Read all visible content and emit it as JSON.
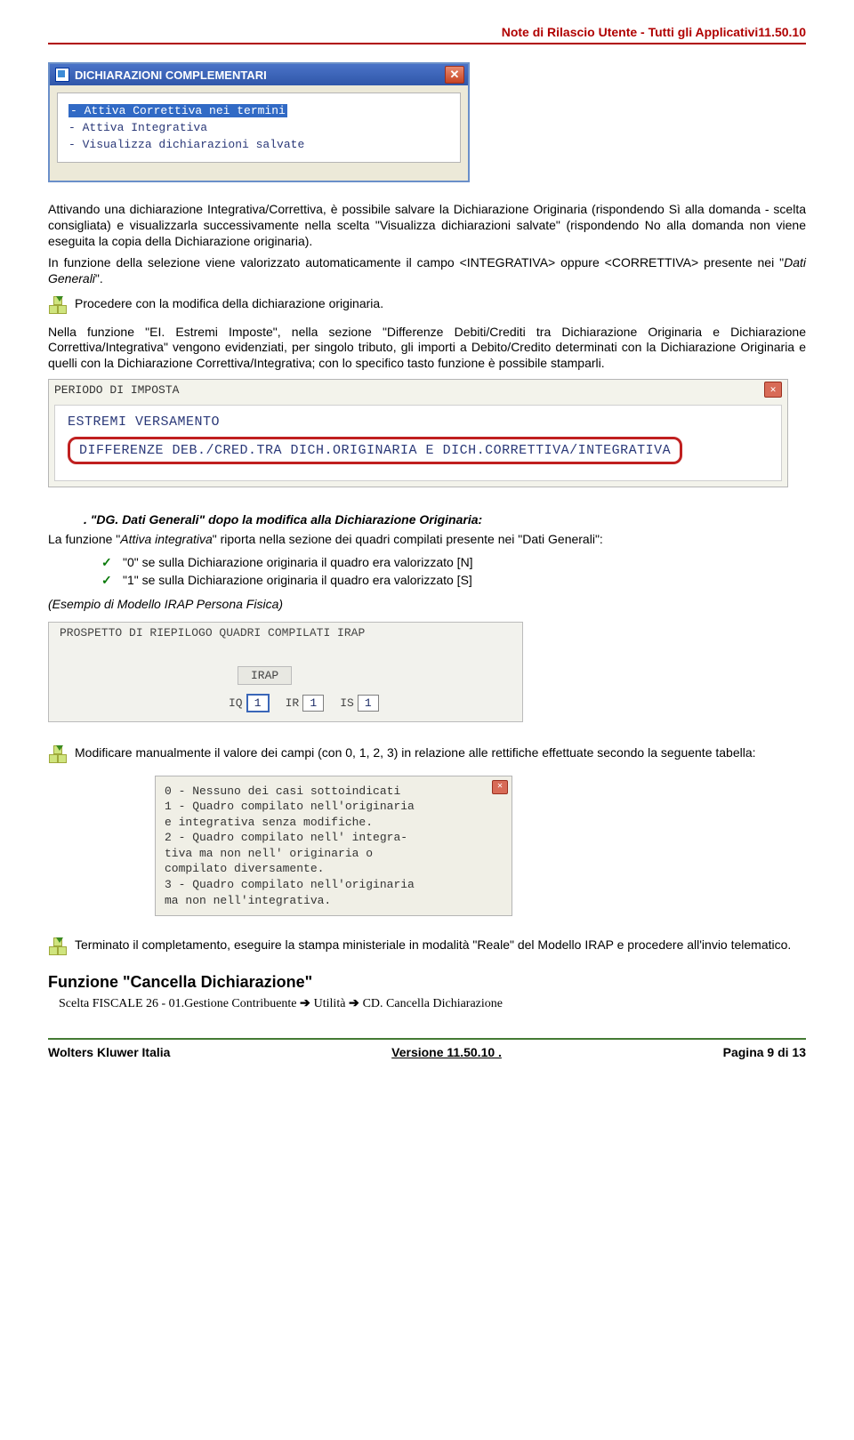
{
  "header": {
    "title": "Note di Rilascio Utente - Tutti gli Applicativi11.50.10"
  },
  "dialog1": {
    "title": "DICHIARAZIONI COMPLEMENTARI",
    "items": [
      "- Attiva Correttiva nei termini",
      "- Attiva Integrativa",
      "- Visualizza dichiarazioni salvate"
    ]
  },
  "para1": "Attivando una dichiarazione Integrativa/Correttiva, è possibile salvare la Dichiarazione Originaria (rispondendo Sì alla domanda - scelta consigliata) e visualizzarla successivamente nella scelta \"Visualizza dichiarazioni salvate\" (rispondendo No alla domanda non viene eseguita la copia della Dichiarazione originaria).",
  "para2a": "In funzione della selezione viene valorizzato automaticamente il campo <INTEGRATIVA> oppure <CORRETTIVA> presente nei \"",
  "para2b": "Dati Generali",
  "para2c": "\".",
  "note1": "Procedere con la modifica della dichiarazione originaria.",
  "para3": "Nella funzione \"EI. Estremi Imposte\", nella sezione \"Differenze Debiti/Crediti tra Dichiarazione Originaria e Dichiarazione Correttiva/Integrativa\" vengono evidenziati, per singolo tributo, gli importi a Debito/Credito determinati con la Dichiarazione Originaria e quelli con la Dichiarazione Correttiva/Integrativa; con lo specifico tasto funzione è possibile stamparli.",
  "dialog2": {
    "title": "PERIODO DI IMPOSTA",
    "l1": "ESTREMI VERSAMENTO",
    "l2": "DIFFERENZE DEB./CRED.TRA DICH.ORIGINARIA E DICH.CORRETTIVA/INTEGRATIVA"
  },
  "ital_lead": ". \"DG. Dati Generali\" dopo la modifica alla Dichiarazione Originaria:",
  "para4a": "La funzione \"",
  "para4b": "Attiva integrativa",
  "para4c": "\" riporta nella sezione dei quadri compilati presente nei \"Dati Generali\":",
  "checks": [
    "\"0\" se sulla Dichiarazione originaria il quadro era valorizzato [N]",
    "\"1\" se sulla Dichiarazione originaria il quadro era valorizzato [S]"
  ],
  "paren": "(Esempio di Modello IRAP Persona Fisica)",
  "quadri": {
    "title": "PROSPETTO DI RIEPILOGO QUADRI COMPILATI IRAP",
    "irap": "IRAP",
    "fields": [
      {
        "lbl": "IQ",
        "val": "1",
        "selected": true
      },
      {
        "lbl": "IR",
        "val": "1",
        "selected": false
      },
      {
        "lbl": "IS",
        "val": "1",
        "selected": false
      }
    ]
  },
  "note2": "Modificare manualmente il valore dei campi (con 0, 1, 2, 3) in relazione alle rettifiche effettuate secondo la seguente tabella:",
  "tooltip": {
    "r0": "0 - Nessuno dei casi sottoindicati",
    "r1a": "1 - Quadro compilato nell'originaria",
    "r1b": "    e integrativa senza modifiche.",
    "r2a": "2 - Quadro compilato nell' integra-",
    "r2b": "    tiva ma non nell' originaria o",
    "r2c": "    compilato diversamente.",
    "r3a": "3 - Quadro compilato nell'originaria",
    "r3b": "    ma non nell'integrativa."
  },
  "note3": "Terminato il completamento, eseguire la stampa ministeriale in modalità \"Reale\" del Modello IRAP e procedere all'invio telematico.",
  "section_h": "Funzione \"Cancella Dichiarazione\"",
  "breadcrumb": {
    "p1": "Scelta FISCALE 26 - 01.Gestione Contribuente",
    "p2": "Utilità",
    "p3": "CD. Cancella Dichiarazione"
  },
  "footer": {
    "left": "Wolters Kluwer Italia",
    "mid": "Versione  11.50.10 .",
    "right": "Pagina  9 di 13"
  }
}
